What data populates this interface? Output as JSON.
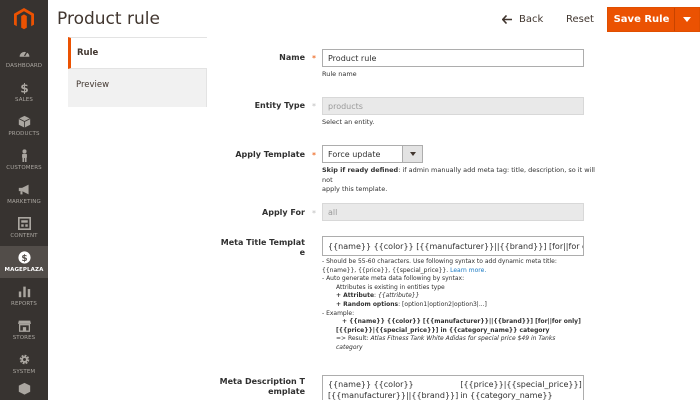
{
  "nav": {
    "items": [
      {
        "label": "DASHBOARD",
        "icon": "speedometer-icon"
      },
      {
        "label": "SALES",
        "icon": "dollar-icon"
      },
      {
        "label": "PRODUCTS",
        "icon": "box-icon"
      },
      {
        "label": "CUSTOMERS",
        "icon": "person-icon"
      },
      {
        "label": "MARKETING",
        "icon": "megaphone-icon"
      },
      {
        "label": "CONTENT",
        "icon": "layout-icon"
      },
      {
        "label": "MAGEPLAZA",
        "icon": "mageplaza-icon"
      },
      {
        "label": "REPORTS",
        "icon": "bar-chart-icon"
      },
      {
        "label": "STORES",
        "icon": "storefront-icon"
      },
      {
        "label": "SYSTEM",
        "icon": "gear-icon"
      }
    ]
  },
  "header": {
    "title": "Product rule",
    "back_label": "Back",
    "reset_label": "Reset",
    "save_label": "Save Rule"
  },
  "tabs": [
    "Rule",
    "Preview"
  ],
  "form": {
    "name": {
      "label": "Name",
      "value": "Product rule",
      "note": "Rule name"
    },
    "entity_type": {
      "label": "Entity Type",
      "placeholder": "products",
      "note": "Select an entity."
    },
    "apply_template": {
      "label": "Apply Template",
      "selected": "Force update",
      "note_bold": "Skip if ready defined",
      "note_line1_rest": ": if admin manually add meta tag: title, description, so it will not",
      "note_line2": "apply this template."
    },
    "apply_for": {
      "label": "Apply For",
      "placeholder": "all"
    },
    "meta_title": {
      "label_line1": "Meta Title Templat",
      "label_line2": "e",
      "value": "{{name}} {{color}} [{{manufacturer}}||{{brand}}] [for||for only] [{{pri"
    },
    "help": {
      "l1_prefix": "- Should be 55-60 characters. Use following syntax to add dynamic meta title:",
      "l2_prefix": "{{name}}, {{price}}, {{special_price}}.",
      "l2_link": "Learn more.",
      "l3": "- Auto generate meta data following by syntax:",
      "l4": "Attributes is existing in entities type",
      "l5_bold": "+ Attribute",
      "l5_rest": ": ",
      "l5_italic": "{{attribute}}",
      "l6_bold": "+ Random options",
      "l6_rest": ": [option1|option2|option3|...]",
      "l7": "- Example:",
      "l8": "+ {{name}} {{color}} [{{manufacturer}}||{{brand}}] [for||for only]",
      "l9": "[{{price}}|{{special_price}}] in {{category_name}} category",
      "l10_prefix": "=> Result: ",
      "l10_italic": "Atlas Fitness Tank White Adidas for special price $49 in Tanks",
      "l11_italic": "category"
    },
    "meta_description": {
      "label_line1": "Meta Description T",
      "label_line2": "emplate",
      "value_line1": "{{name}} {{color}} [{{manufacturer}}||{{brand}}] [for||for only]",
      "value_line2": "[{{price}}|{{special_price}}] in {{category_name}} category"
    }
  },
  "colors": {
    "accent": "#eb5202",
    "sidebar": "#373330",
    "link": "#1979c3"
  }
}
